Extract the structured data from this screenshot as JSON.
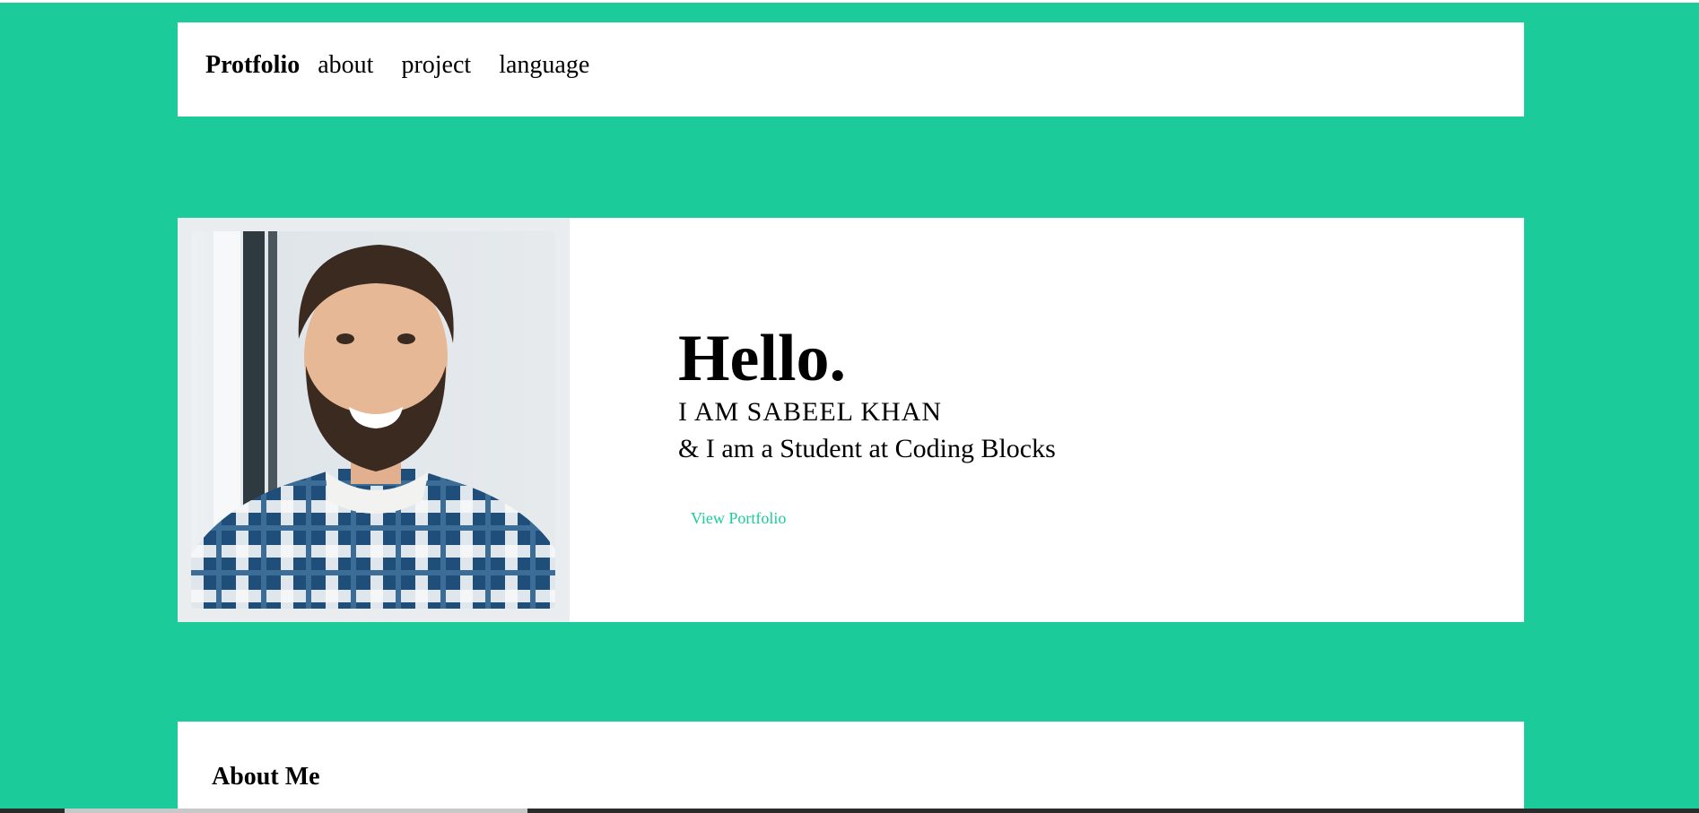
{
  "navbar": {
    "brand": "Protfolio",
    "links": [
      "about",
      "project",
      "language"
    ]
  },
  "hero": {
    "greeting": "Hello.",
    "name": "I AM SABEEL KHAN",
    "tagline": "& I am a Student at Coding Blocks",
    "button_label": "View Portfolio"
  },
  "about": {
    "title": "About Me"
  },
  "colors": {
    "accent": "#1bcb9a",
    "panel": "#ffffff",
    "photo_frame": "#e9edf0",
    "shirt_blue": "#1f4e7a"
  },
  "icons": {
    "profile_photo": "profile-photo"
  }
}
